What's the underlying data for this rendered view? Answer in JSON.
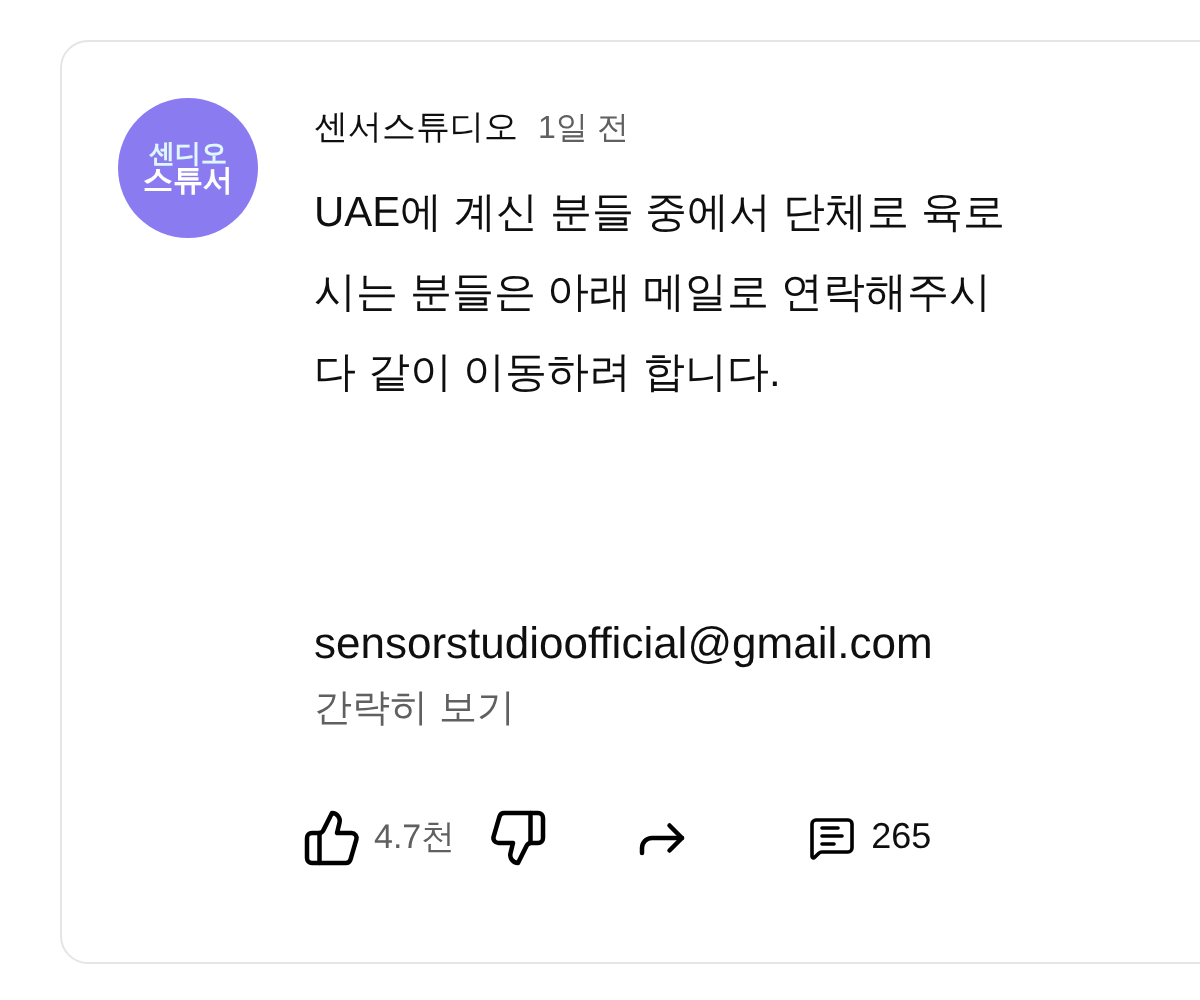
{
  "comment": {
    "avatar_text": [
      "센디오",
      "스튜서"
    ],
    "author": "센서스튜디오",
    "time": "1일 전",
    "body_lines": [
      "UAE에 계신 분들 중에서 단체로 육로",
      "시는 분들은 아래 메일로 연락해주시",
      "다 같이 이동하려 합니다."
    ],
    "email": "sensorstudioofficial@gmail.com",
    "collapse_link": "간략히 보기",
    "likes": "4.7천",
    "replies": "265"
  }
}
